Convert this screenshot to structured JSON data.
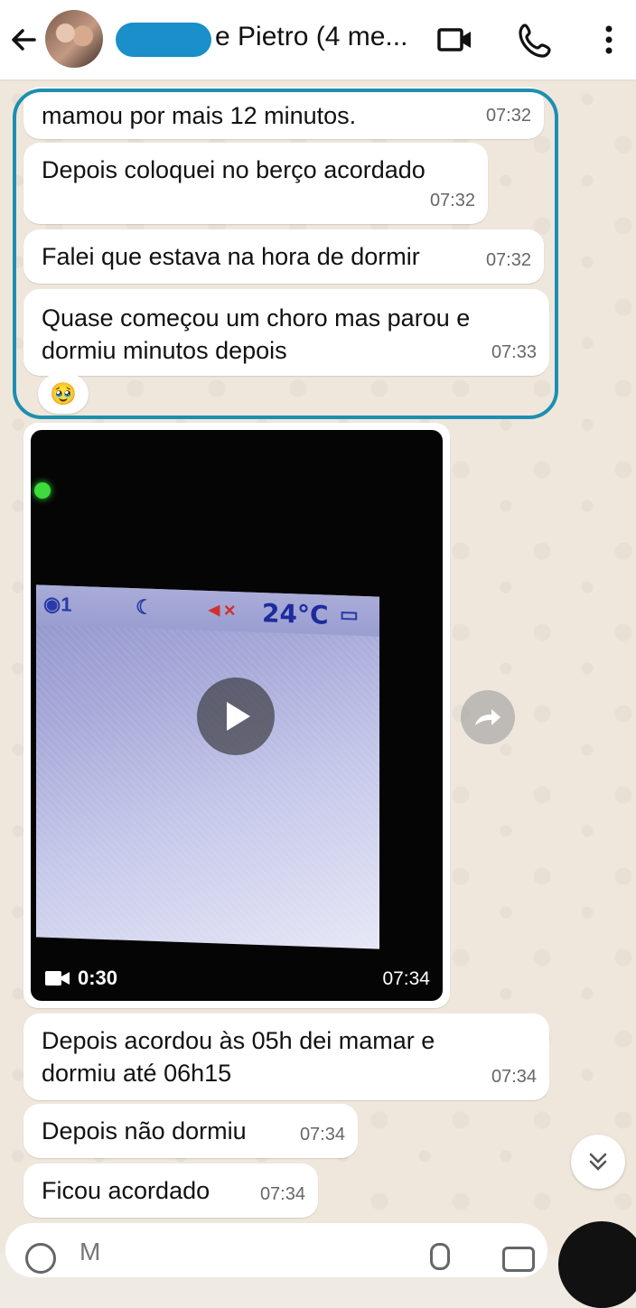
{
  "header": {
    "title": "e Pietro (4 me...",
    "back_icon": "arrow-left-icon",
    "video_icon": "video-camera-icon",
    "call_icon": "phone-icon",
    "menu_icon": "more-vertical-icon"
  },
  "messages": [
    {
      "text": "mamou por mais 12 minutos.",
      "time": "07:32"
    },
    {
      "text": "Depois coloquei no berço acordado",
      "time": "07:32"
    },
    {
      "text": "Falei que estava na hora de dormir",
      "time": "07:32"
    },
    {
      "text": "Quase começou um choro mas parou e\ndormiu minutos depois",
      "time": "07:33",
      "reaction": "🥹"
    },
    {
      "text": "Depois acordou às 05h dei mamar e\ndormiu até 06h15",
      "time": "07:34"
    },
    {
      "text": "Depois não dormiu",
      "time": "07:34"
    },
    {
      "text": "Ficou acordado",
      "time": "07:34"
    }
  ],
  "video": {
    "duration": "0:30",
    "time": "07:34",
    "monitor_temp": "24°C"
  },
  "composer": {
    "placeholder": "M"
  },
  "colors": {
    "highlight": "#1d8fb0",
    "redaction": "#1a8fc9"
  }
}
